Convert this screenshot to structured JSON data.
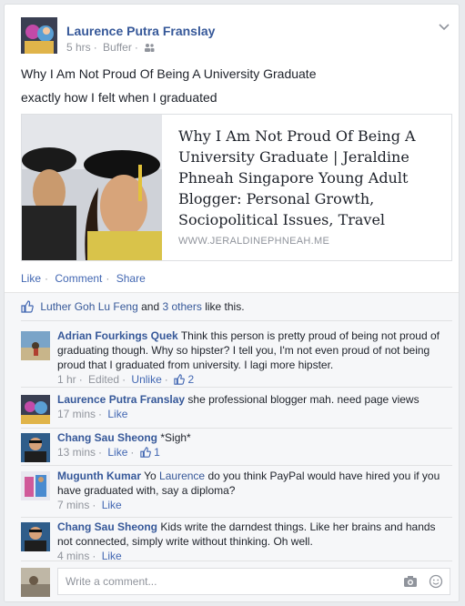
{
  "post": {
    "author": "Laurence Putra Franslay",
    "time": "5 hrs",
    "via": "Buffer",
    "audience_icon": "friends-icon",
    "text_line1": "Why I Am Not Proud Of Being A University Graduate",
    "text_line2": "exactly how I felt when I graduated",
    "link": {
      "title": "Why I Am Not Proud Of Being A University Graduate | Jeraldine Phneah Singapore Young Adult Blogger: Personal Growth, Sociopolitical Issues, Travel",
      "domain": "WWW.JERALDINEPHNEAH.ME"
    },
    "actions": {
      "like": "Like",
      "comment": "Comment",
      "share": "Share"
    }
  },
  "likes": {
    "name": "Luther Goh Lu Feng",
    "and": "and",
    "others": "3 others",
    "suffix": "like this."
  },
  "comments": [
    {
      "author": "Adrian Fourkings Quek",
      "text": "Think this person is pretty proud of being not proud of graduating though. Why so hipster? I tell you, I'm not even proud of not being proud that I graduated from university. I lagi more hipster.",
      "time": "1 hr",
      "edited": "Edited",
      "action": "Unlike",
      "likes": "2"
    },
    {
      "author": "Laurence Putra Franslay",
      "text": "she professional blogger mah. need page views",
      "time": "17 mins",
      "action": "Like"
    },
    {
      "author": "Chang Sau Sheong",
      "text": "*Sigh*",
      "time": "13 mins",
      "action": "Like",
      "likes": "1"
    },
    {
      "author": "Mugunth Kumar",
      "text_pre": "Yo",
      "mention": "Laurence",
      "text": "do you think PayPal would have hired you if you have graduated with, say a diploma?",
      "time": "7 mins",
      "action": "Like"
    },
    {
      "author": "Chang Sau Sheong",
      "text": "Kids write the darndest things. Like her brains and hands not connected, simply write without thinking. Oh well.",
      "time": "4 mins",
      "action": "Like"
    }
  ],
  "composer": {
    "placeholder": "Write a comment..."
  },
  "colors": {
    "link": "#365899",
    "action": "#4267b2",
    "meta": "#90949c",
    "bg": "#e9ebee"
  }
}
